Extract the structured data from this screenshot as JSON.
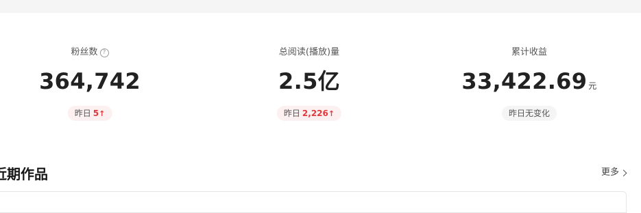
{
  "stats": [
    {
      "label": "粉丝数",
      "help_icon": "question-circle-icon",
      "value": "364,742",
      "unit": "",
      "badge_prefix": "昨日",
      "badge_delta": "5",
      "badge_trend": "up",
      "badge_icon": "arrow-up-icon",
      "arrow_glyph": "↑"
    },
    {
      "label": "总阅读(播放)量",
      "value": "2.5亿",
      "unit": "",
      "badge_prefix": "昨日",
      "badge_delta": "2,226",
      "badge_trend": "up",
      "badge_icon": "arrow-up-icon",
      "arrow_glyph": "↑"
    },
    {
      "label": "累计收益",
      "value": "33,422.69",
      "unit": "元",
      "badge_text": "昨日无变化",
      "badge_trend": "none"
    }
  ],
  "recent_works": {
    "title": "近期作品",
    "more_label": "更多",
    "more_icon": "chevron-right-icon"
  },
  "colors": {
    "accent_red": "#e1393c",
    "badge_up_bg": "#fdf0f0",
    "badge_neutral_bg": "#f5f5f5",
    "top_band_bg": "#f5f5f5"
  },
  "glyphs": {
    "help": "?"
  }
}
